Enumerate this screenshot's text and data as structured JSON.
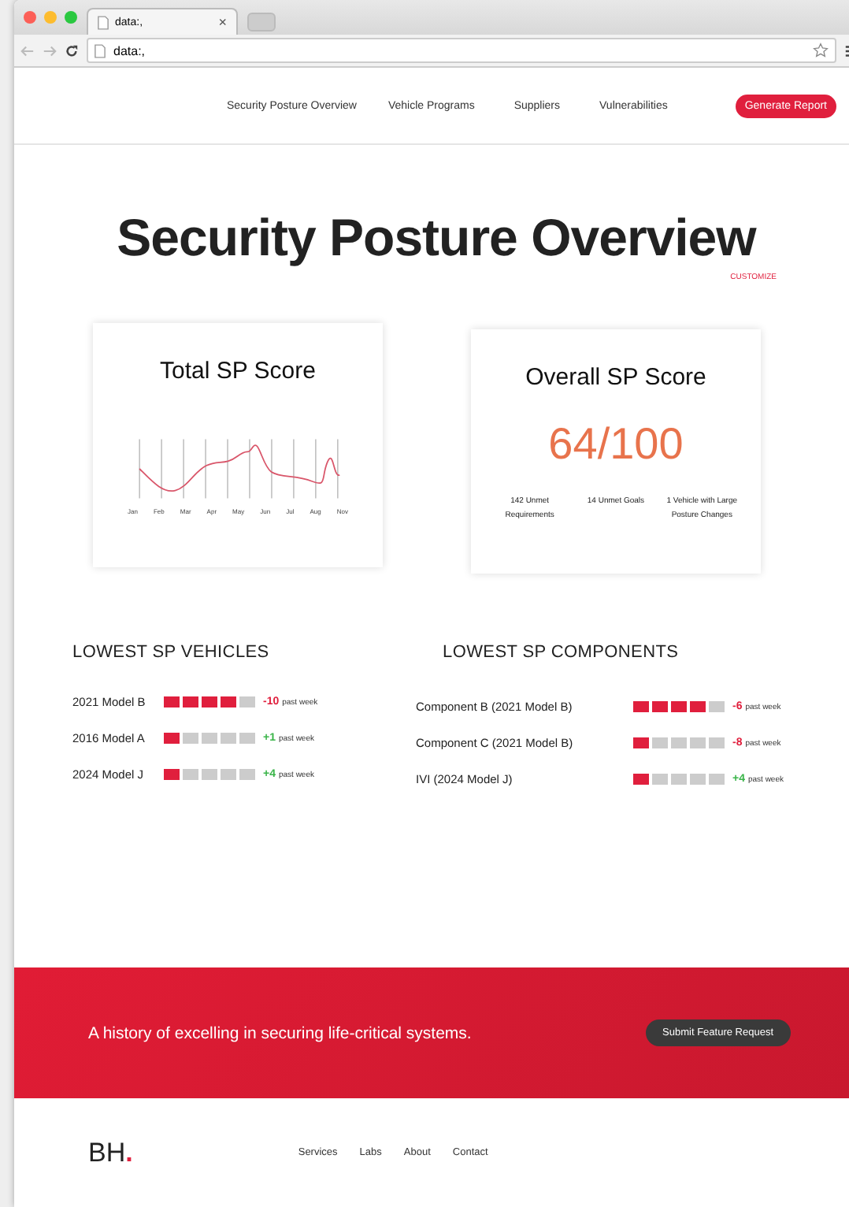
{
  "browser": {
    "tab_title": "data:,",
    "tab_close": "×",
    "address": "data:,"
  },
  "nav": {
    "links": [
      "Security Posture Overview",
      "Vehicle Programs",
      "Suppliers",
      "Vulnerabilities"
    ],
    "button": "Generate Report"
  },
  "heading": "Security Posture Overview",
  "customize": "CUSTOMIZE",
  "total_card": {
    "title": "Total SP Score",
    "month_labels": [
      "Jan",
      "Feb",
      "Mar",
      "Apr",
      "May",
      "Jun",
      "Jul",
      "Aug",
      "Nov"
    ]
  },
  "overall_card": {
    "title": "Overall SP Score",
    "score": "64/100",
    "stats": [
      "142 Unmet Requirements",
      "14 Unmet Goals",
      "1 Vehicle with Large Posture Changes"
    ]
  },
  "sections": [
    {
      "title": "LOWEST SP VEHICLES",
      "rows": [
        {
          "name": "2021 Model B",
          "level": 0.8,
          "change": "-10",
          "color": "#e01f3d",
          "suffix": "past week"
        },
        {
          "name": "2016 Model A",
          "level": 0.2,
          "change": "+1",
          "color": "#3bb54a",
          "suffix": "past week"
        },
        {
          "name": "2024 Model J",
          "level": 0.2,
          "change": "+4",
          "color": "#3bb54a",
          "suffix": "past week"
        }
      ]
    },
    {
      "title": "LOWEST SP COMPONENTS",
      "rows": [
        {
          "name": "Component B (2021 Model B)",
          "level": 0.8,
          "change": "-6",
          "color": "#e01f3d",
          "suffix": "past week"
        },
        {
          "name": "Component C (2021 Model B)",
          "level": 0.2,
          "change": "-8",
          "color": "#e01f3d",
          "suffix": "past week"
        },
        {
          "name": "IVI (2024 Model J)",
          "level": 0.2,
          "change": "+4",
          "color": "#3bb54a",
          "suffix": "past week"
        }
      ]
    }
  ],
  "banner": {
    "text": "A history of excelling in securing life-critical systems.",
    "button": "Submit Feature Request"
  },
  "footer": {
    "logo": "BH",
    "logo_mark": ".",
    "links": [
      "Services",
      "Labs",
      "About",
      "Contact"
    ]
  }
}
